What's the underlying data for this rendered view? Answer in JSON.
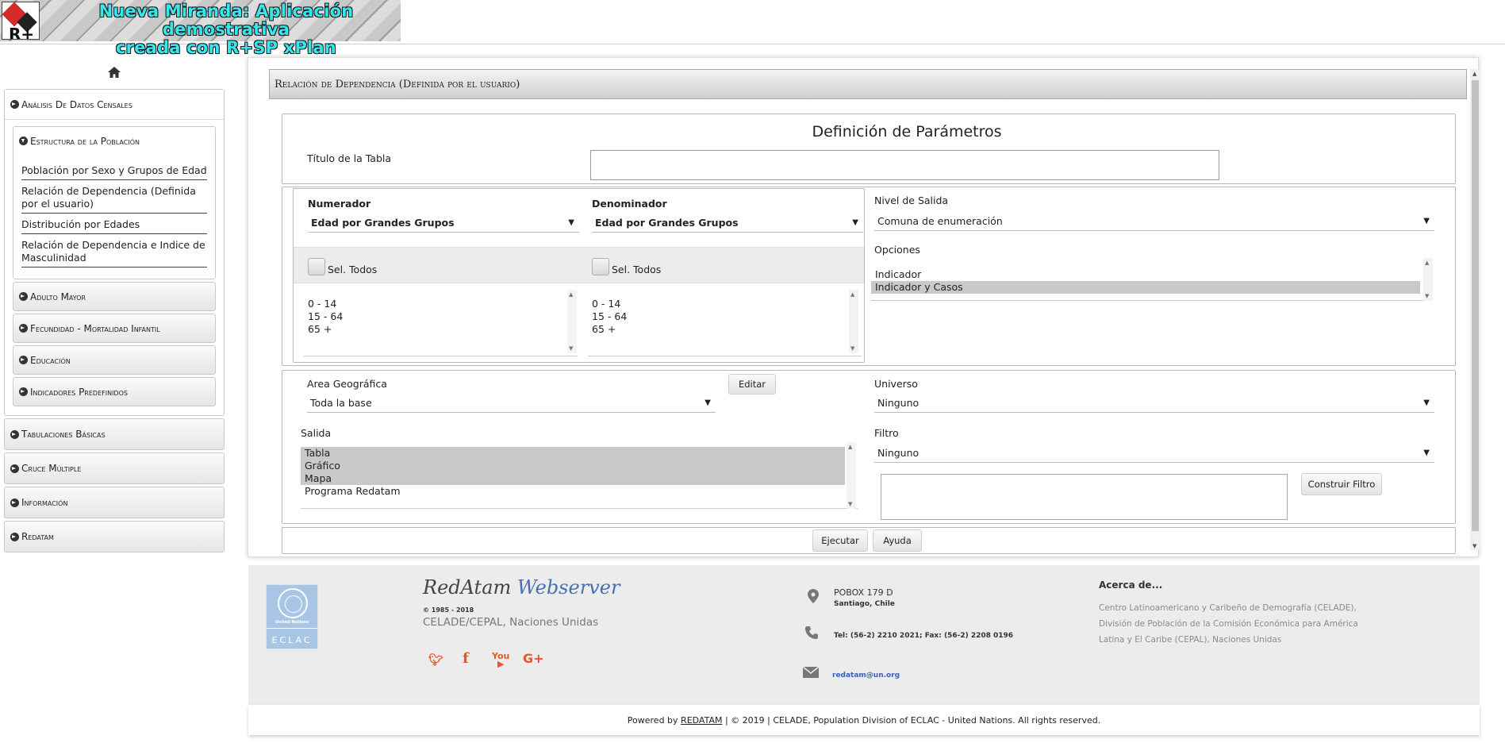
{
  "header": {
    "title_line1": "Nueva Miranda: Aplicación demostrativa",
    "title_line2": "creada con R+SP xPlan"
  },
  "sidebar": {
    "sections": [
      {
        "label": "Análisis De Datos Censales",
        "open": true
      },
      {
        "label": "Tabulaciones Básicas"
      },
      {
        "label": "Cruce Múltiple"
      },
      {
        "label": "Información"
      },
      {
        "label": "Redatam"
      }
    ],
    "subsections": [
      {
        "label": "Estructura de la Población",
        "open": true
      },
      {
        "label": "Adulto Mayor"
      },
      {
        "label": "Fecundidad - Mortalidad Infantil"
      },
      {
        "label": "Educación"
      },
      {
        "label": "Indicadores Predefinidos"
      }
    ],
    "links": [
      "Población por Sexo y Grupos de Edad",
      "Relación de Dependencia (Definida por el usuario)",
      "Distribución por Edades",
      "Relación de Dependencia e Indice de Masculinidad"
    ]
  },
  "panel": {
    "title": "Relación de Dependencia (Definida por el usuario)",
    "params_title": "Definición de Parámetros",
    "table_title_label": "Título de la Tabla",
    "table_title_value": "",
    "numerador": {
      "label": "Numerador",
      "selected": "Edad por Grandes Grupos",
      "select_all": "Sel. Todos",
      "options": [
        "0 - 14",
        "15 - 64",
        "65 +"
      ]
    },
    "denominador": {
      "label": "Denominador",
      "selected": "Edad por Grandes Grupos",
      "select_all": "Sel. Todos",
      "options": [
        "0 - 14",
        "15 - 64",
        "65 +"
      ]
    },
    "nivel_salida": {
      "label": "Nivel de Salida",
      "selected": "Comuna de enumeración"
    },
    "opciones": {
      "label": "Opciones",
      "options": [
        "Indicador",
        "Indicador y Casos"
      ]
    },
    "area": {
      "label": "Area Geográfica",
      "selected": "Toda la base",
      "edit_button": "Editar"
    },
    "universo": {
      "label": "Universo",
      "selected": "Ninguno"
    },
    "salida": {
      "label": "Salida",
      "options": [
        "Tabla",
        "Gráfico",
        "Mapa",
        "Programa Redatam"
      ]
    },
    "filtro": {
      "label": "Filtro",
      "selected": "Ninguno",
      "build_button": "Construir Filtro"
    },
    "run_button": "Ejecutar",
    "help_button": "Ayuda"
  },
  "footer": {
    "brand_a": "RedAtam",
    "brand_b": "Webserver",
    "copyright_years": "© 1985 - 2018",
    "org": "CELADE/CEPAL, Naciones Unidas",
    "un_caption": "United Nations",
    "un_acronym": "ECLAC",
    "address_line1": "POBOX 179 D",
    "address_line2": "Santiago, Chile",
    "phone": "Tel: (56-2) 2210 2021; Fax: (56-2) 2208 0196",
    "email": "redatam@un.org",
    "about_title": "Acerca de...",
    "about_lines": [
      "Centro Latinoamericano y Caribeño de Demografía (CELADE),",
      "División de Población de la Comisión Económica para América",
      "Latina y El Caribe (CEPAL), Naciones Unidas"
    ],
    "social": [
      "twitter",
      "facebook",
      "youtube",
      "google-plus"
    ],
    "powered_prefix": "Powered by",
    "powered_link": "REDATAM",
    "powered_suffix": "| © 2019 | CELADE, Population Division of ECLAC - United Nations. All rights reserved."
  }
}
